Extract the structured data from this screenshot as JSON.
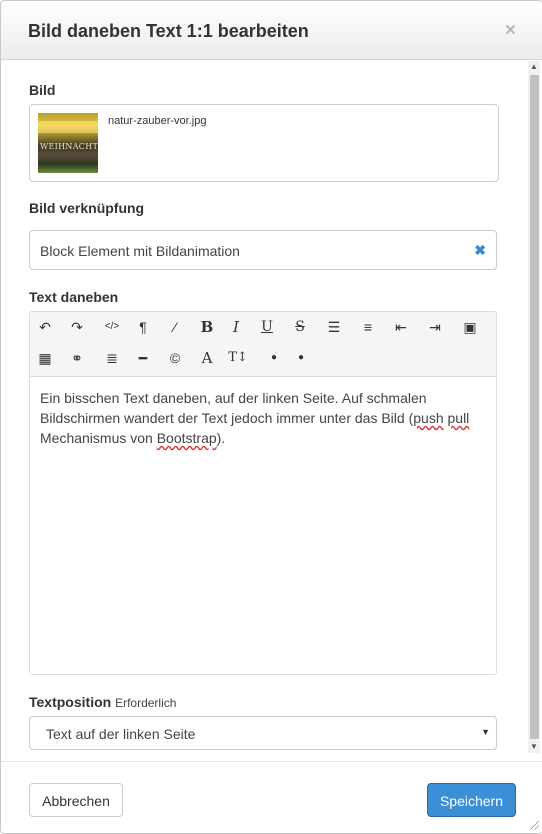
{
  "dialog": {
    "title": "Bild daneben Text 1:1 bearbeiten",
    "close_icon": "×"
  },
  "bild": {
    "label": "Bild",
    "filename": "natur-zauber-vor.jpg",
    "thumb_text": "WEIHNACHT"
  },
  "verknuepfung": {
    "label": "Bild verknüpfung",
    "value": "Block Element mit Bildanimation",
    "clear_icon": "✖"
  },
  "text_daneben": {
    "label": "Text daneben",
    "toolbar": [
      {
        "name": "undo-icon",
        "glyph": "↶"
      },
      {
        "name": "redo-icon",
        "glyph": "↷"
      },
      {
        "name": "code-view-icon",
        "glyph": "</>"
      },
      {
        "name": "paragraph-icon",
        "glyph": "¶"
      },
      {
        "name": "magic-wand-icon",
        "glyph": "⁄"
      },
      {
        "name": "bold-icon",
        "glyph": "B"
      },
      {
        "name": "italic-icon",
        "glyph": "I"
      },
      {
        "name": "underline-icon",
        "glyph": "U"
      },
      {
        "name": "strikethrough-icon",
        "glyph": "S"
      },
      {
        "name": "unordered-list-icon",
        "glyph": "☰"
      },
      {
        "name": "ordered-list-icon",
        "glyph": "≡"
      },
      {
        "name": "outdent-icon",
        "glyph": "⇤"
      },
      {
        "name": "indent-icon",
        "glyph": "⇥"
      },
      {
        "name": "image-icon",
        "glyph": "▣"
      },
      {
        "name": "table-icon",
        "glyph": "▦"
      },
      {
        "name": "link-icon",
        "glyph": "⚭"
      },
      {
        "name": "align-icon",
        "glyph": "≣"
      },
      {
        "name": "horizontal-rule-icon",
        "glyph": "━"
      },
      {
        "name": "copyright-icon",
        "glyph": "©"
      },
      {
        "name": "font-icon",
        "glyph": "A"
      },
      {
        "name": "font-size-icon",
        "glyph": "T↕"
      },
      {
        "name": "text-color-icon",
        "glyph": "●"
      },
      {
        "name": "background-color-icon",
        "glyph": "●"
      }
    ],
    "content": {
      "line1": "Ein bisschen Text daneben, auf der linken Seite. Auf schmalen",
      "line2_pre": "Bildschirmen wandert der Text jedoch immer unter das Bild (",
      "push": "push",
      "space": " ",
      "pull": "pull",
      "line3_pre": "Mechanismus von ",
      "bootstrap": "Bootstrap",
      "line3_post": ")."
    }
  },
  "textposition": {
    "label": "Textposition",
    "required": "Erforderlich",
    "value": "Text auf der linken Seite",
    "caret": "▼"
  },
  "footer": {
    "cancel_label": "Abbrechen",
    "save_label": "Speichern"
  },
  "colors": {
    "primary": "#3b8fd6",
    "clear_icon": "#3b8bd0"
  }
}
